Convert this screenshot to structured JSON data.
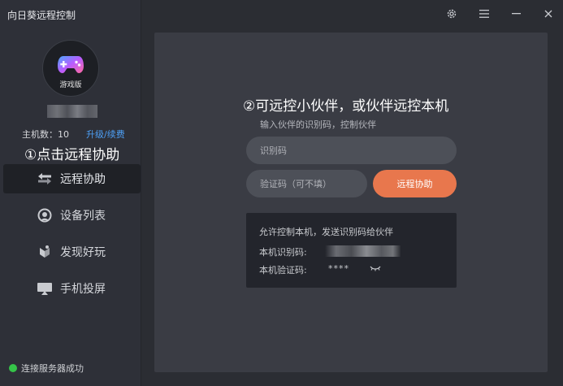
{
  "app": {
    "title": "向日葵远程控制"
  },
  "sidebar": {
    "avatar_label": "游戏版",
    "host_count": "主机数：10",
    "upgrade_link": "升级/续费",
    "step1_label": "①点击远程协助",
    "nav": [
      {
        "label": "远程协助",
        "icon": "remote-assist-icon",
        "active": true
      },
      {
        "label": "设备列表",
        "icon": "device-list-icon",
        "active": false
      },
      {
        "label": "发现好玩",
        "icon": "discover-icon",
        "active": false
      },
      {
        "label": "手机投屏",
        "icon": "screen-cast-icon",
        "active": false
      }
    ],
    "status": "连接服务器成功"
  },
  "titlebar": {
    "icons": [
      "gear-icon",
      "menu-icon",
      "minimize-icon",
      "close-icon"
    ]
  },
  "main": {
    "step2_label": "②可远控小伙伴，或伙伴远控本机",
    "hint": "输入伙伴的识别码，控制伙伴",
    "code_placeholder": "识别码",
    "code_value": "",
    "verify_placeholder": "验证码（可不填）",
    "verify_value": "",
    "connect_button": "远程协助",
    "info": {
      "title": "允许控制本机，发送识别码给伙伴",
      "id_label": "本机识别码:",
      "pwd_label": "本机验证码:",
      "pwd_value": "****"
    }
  },
  "colors": {
    "accent": "#e8774d",
    "link": "#4d9ff5",
    "status_ok": "#35c449",
    "panel": "#3a3c44",
    "sidebar": "#2e3038"
  }
}
